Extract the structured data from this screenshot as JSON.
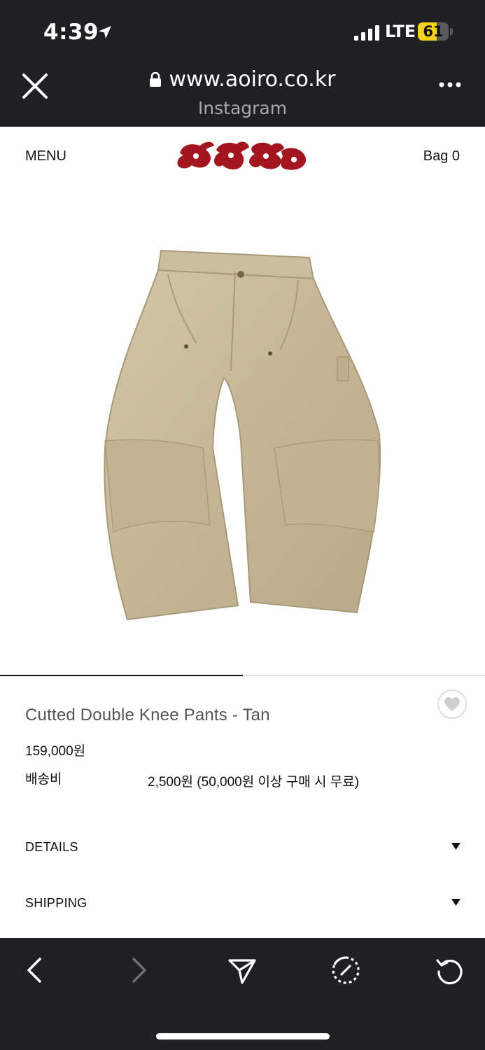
{
  "status_bar": {
    "time": "4:39",
    "network": "LTE",
    "battery_level": "61",
    "battery_fraction": 0.61,
    "icons": [
      "location-arrow-icon",
      "signal-bars-icon",
      "battery-icon"
    ]
  },
  "browser": {
    "url": "www.aoiro.co.kr",
    "source": "Instagram",
    "icons": [
      "close-icon",
      "lock-icon",
      "more-icon"
    ]
  },
  "site_header": {
    "menu_label": "MENU",
    "logo_text": "aoiro",
    "bag_label": "Bag 0"
  },
  "product": {
    "image_alt": "tan double knee pants",
    "image_index": 1,
    "image_count": 2,
    "title": "Cutted Double Knee Pants - Tan",
    "price": "159,000원",
    "shipping_label": "배송비",
    "shipping_value": "2,500원 (50,000원 이상 구매 시 무료)"
  },
  "sections": [
    {
      "label": "DETAILS"
    },
    {
      "label": "SHIPPING"
    }
  ],
  "bottom_nav": {
    "icons": [
      "back-icon",
      "forward-icon",
      "share-icon",
      "open-in-safari-icon",
      "reload-icon"
    ]
  },
  "colors": {
    "chrome": "#1f2024",
    "battery": "#f5d21a",
    "logo_red": "#a3161f",
    "pants_tan": "#c9bb9b"
  }
}
